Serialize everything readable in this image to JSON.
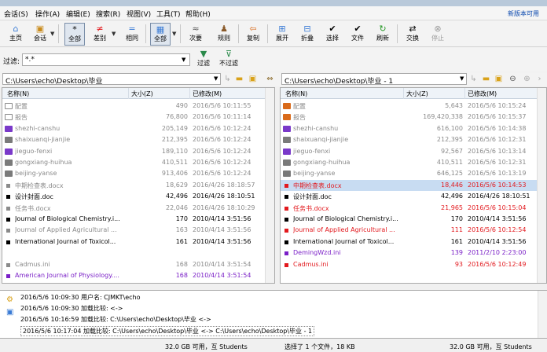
{
  "menu": [
    "会话(S)",
    "操作(A)",
    "编辑(E)",
    "搜索(R)",
    "视图(V)",
    "工具(T)",
    "帮助(H)"
  ],
  "new_version": "新版本可用",
  "toolbar": {
    "home": "主页",
    "sessions": "会话",
    "all": "全部",
    "diffs": "差别",
    "same": "相同",
    "structure": "全部",
    "minor": "次要",
    "rules": "规则",
    "copy": "复制",
    "expand": "展开",
    "collapse": "折叠",
    "select": "选择",
    "files": "文件",
    "refresh": "刷新",
    "swap": "交换",
    "stop": "停止"
  },
  "filter": {
    "label": "过滤:",
    "value": "*.*",
    "filter_btn": "过滤",
    "unfilter_btn": "不过滤"
  },
  "left": {
    "path": "C:\\Users\\echo\\Desktop\\毕业",
    "headers": {
      "name": "名称(N)",
      "size": "大小(Z)",
      "modified": "已修改(M)"
    },
    "rows": [
      {
        "name": "配置",
        "size": "490",
        "date": "2016/5/6 10:11:55",
        "icon": "folder-empty",
        "color": "grey"
      },
      {
        "name": "报告",
        "size": "76,800",
        "date": "2016/5/6 10:11:14",
        "icon": "folder-empty",
        "color": "grey"
      },
      {
        "name": "shezhi-canshu",
        "size": "205,149",
        "date": "2016/5/6 10:12:24",
        "icon": "folder-purple",
        "color": "grey"
      },
      {
        "name": "shaixuanqi-jianjie",
        "size": "212,395",
        "date": "2016/5/6 10:12:24",
        "icon": "folder-grey",
        "color": "grey"
      },
      {
        "name": "jieguo-fenxi",
        "size": "189,110",
        "date": "2016/5/6 10:12:24",
        "icon": "folder-purple",
        "color": "grey"
      },
      {
        "name": "gongxiang-huihua",
        "size": "410,511",
        "date": "2016/5/6 10:12:24",
        "icon": "folder-grey",
        "color": "grey"
      },
      {
        "name": "beijing-yanse",
        "size": "913,406",
        "date": "2016/5/6 10:12:24",
        "icon": "folder-grey",
        "color": "grey"
      },
      {
        "name": "中期检查表.docx",
        "size": "18,629",
        "date": "2016/4/26 18:18:57",
        "icon": "bullet-grey",
        "color": "grey"
      },
      {
        "name": "设计封面.doc",
        "size": "42,496",
        "date": "2016/4/26 18:10:51",
        "icon": "bullet-black",
        "color": "black"
      },
      {
        "name": "任务书.docx",
        "size": "22,046",
        "date": "2016/4/26 18:10:29",
        "icon": "bullet-grey",
        "color": "grey"
      },
      {
        "name": "Journal of Biological Chemistry.i...",
        "size": "170",
        "date": "2010/4/14 3:51:56",
        "icon": "bullet-black",
        "color": "black"
      },
      {
        "name": "Journal of Applied Agricultural ...",
        "size": "163",
        "date": "2010/4/14 3:51:56",
        "icon": "bullet-grey",
        "color": "grey"
      },
      {
        "name": "International Journal of Toxicol...",
        "size": "161",
        "date": "2010/4/14 3:51:56",
        "icon": "bullet-black",
        "color": "black"
      },
      {
        "name": "",
        "size": "",
        "date": "",
        "icon": "",
        "color": "grey"
      },
      {
        "name": "Cadmus.ini",
        "size": "168",
        "date": "2010/4/14 3:51:54",
        "icon": "bullet-grey",
        "color": "grey"
      },
      {
        "name": "American Journal of Physiology....",
        "size": "168",
        "date": "2010/4/14 3:51:54",
        "icon": "bullet-purple",
        "color": "purple"
      }
    ]
  },
  "right": {
    "path": "C:\\Users\\echo\\Desktop\\毕业 - 1",
    "headers": {
      "name": "名称(N)",
      "size": "大小(Z)",
      "modified": "已修改(M)"
    },
    "rows": [
      {
        "name": "配置",
        "size": "5,643",
        "date": "2016/5/6 10:15:24",
        "icon": "folder-orange",
        "color": "grey"
      },
      {
        "name": "报告",
        "size": "169,420,338",
        "date": "2016/5/6 10:15:37",
        "icon": "folder-orange",
        "color": "grey"
      },
      {
        "name": "shezhi-canshu",
        "size": "616,100",
        "date": "2016/5/6 10:14:38",
        "icon": "folder-purple",
        "color": "grey"
      },
      {
        "name": "shaixuanqi-jianjie",
        "size": "212,395",
        "date": "2016/5/6 10:12:31",
        "icon": "folder-grey",
        "color": "grey"
      },
      {
        "name": "jieguo-fenxi",
        "size": "92,567",
        "date": "2016/5/6 10:13:14",
        "icon": "folder-purple",
        "color": "grey"
      },
      {
        "name": "gongxiang-huihua",
        "size": "410,511",
        "date": "2016/5/6 10:12:31",
        "icon": "folder-grey",
        "color": "grey"
      },
      {
        "name": "beijing-yanse",
        "size": "646,125",
        "date": "2016/5/6 10:13:19",
        "icon": "folder-grey",
        "color": "grey"
      },
      {
        "name": "中期检查表.docx",
        "size": "18,446",
        "date": "2016/5/6 10:14:53",
        "icon": "bullet-red",
        "color": "red",
        "selected": true
      },
      {
        "name": "设计封面.doc",
        "size": "42,496",
        "date": "2016/4/26 18:10:51",
        "icon": "bullet-black",
        "color": "black"
      },
      {
        "name": "任务书.docx",
        "size": "21,965",
        "date": "2016/5/6 10:15:04",
        "icon": "bullet-red",
        "color": "red"
      },
      {
        "name": "Journal of Biological Chemistry.i...",
        "size": "170",
        "date": "2010/4/14 3:51:56",
        "icon": "bullet-black",
        "color": "black"
      },
      {
        "name": "Journal of Applied Agricultural ...",
        "size": "111",
        "date": "2016/5/6 10:12:54",
        "icon": "bullet-red",
        "color": "red"
      },
      {
        "name": "International Journal of Toxicol...",
        "size": "161",
        "date": "2010/4/14 3:51:56",
        "icon": "bullet-black",
        "color": "black"
      },
      {
        "name": "DemingWzd.ini",
        "size": "139",
        "date": "2011/2/10 2:23:00",
        "icon": "bullet-purple",
        "color": "purple"
      },
      {
        "name": "Cadmus.ini",
        "size": "93",
        "date": "2016/5/6 10:12:49",
        "icon": "bullet-red",
        "color": "red"
      },
      {
        "name": "",
        "size": "",
        "date": "",
        "icon": "",
        "color": "grey"
      }
    ]
  },
  "log": [
    "2016/5/6 10:09:30  用户名: CJMKT\\echo",
    "2016/5/6 10:09:30  加载比较: <->",
    "2016/5/6 10:16:59  加载比较: C:\\Users\\echo\\Desktop\\毕业 <->",
    "2016/5/6 10:17:04  加载比较: C:\\Users\\echo\\Desktop\\毕业 <-> C:\\Users\\echo\\Desktop\\毕业 - 1"
  ],
  "status": {
    "left": "32.0 GB 可用，互 Students",
    "mid": "选择了 1 个文件，18 KB",
    "right": "32.0 GB 可用，互 Students"
  }
}
